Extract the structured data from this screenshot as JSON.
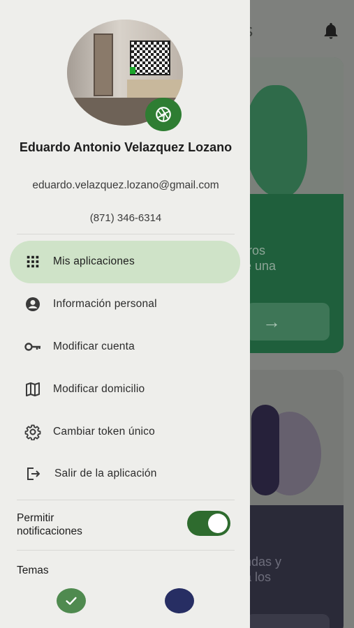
{
  "background": {
    "title_fragment": "s",
    "card1_text_line1": "tros",
    "card1_text_line2": "e una",
    "card2_text_line1": "ndas y",
    "card2_text_line2": "a los"
  },
  "profile": {
    "name": "Eduardo Antonio Velazquez Lozano",
    "email": "eduardo.velazquez.lozano@gmail.com",
    "phone": "(871) 346-6314"
  },
  "menu": {
    "items": [
      {
        "label": "Mis aplicaciones",
        "icon": "grid-icon"
      },
      {
        "label": "Información personal",
        "icon": "account-circle-icon"
      },
      {
        "label": "Modificar cuenta",
        "icon": "key-icon"
      },
      {
        "label": "Modificar domicilio",
        "icon": "map-icon"
      },
      {
        "label": "Cambiar token único",
        "icon": "gear-icon"
      },
      {
        "label": "Salir de la aplicación",
        "icon": "logout-icon"
      }
    ]
  },
  "settings": {
    "notifications_label": "Permitir notificaciones",
    "notifications_enabled": true,
    "themes_label": "Temas"
  },
  "colors": {
    "accent_green": "#2e7d32",
    "active_item_bg": "#cfe3c8",
    "theme_green": "#4f8a4f",
    "theme_navy": "#272e63"
  }
}
